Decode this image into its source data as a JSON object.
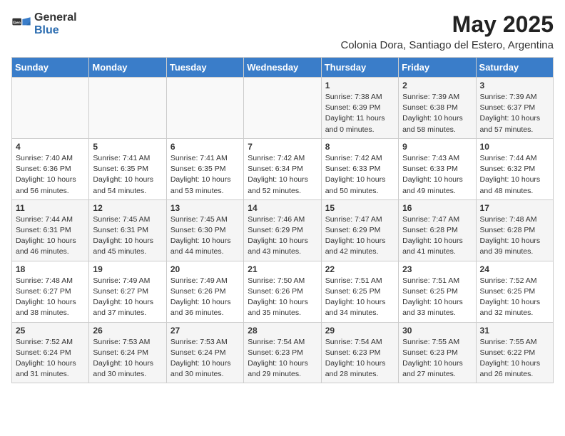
{
  "logo": {
    "general": "General",
    "blue": "Blue"
  },
  "title": "May 2025",
  "subtitle": "Colonia Dora, Santiago del Estero, Argentina",
  "days_of_week": [
    "Sunday",
    "Monday",
    "Tuesday",
    "Wednesday",
    "Thursday",
    "Friday",
    "Saturday"
  ],
  "weeks": [
    [
      {
        "num": "",
        "info": ""
      },
      {
        "num": "",
        "info": ""
      },
      {
        "num": "",
        "info": ""
      },
      {
        "num": "",
        "info": ""
      },
      {
        "num": "1",
        "info": "Sunrise: 7:38 AM\nSunset: 6:39 PM\nDaylight: 11 hours\nand 0 minutes."
      },
      {
        "num": "2",
        "info": "Sunrise: 7:39 AM\nSunset: 6:38 PM\nDaylight: 10 hours\nand 58 minutes."
      },
      {
        "num": "3",
        "info": "Sunrise: 7:39 AM\nSunset: 6:37 PM\nDaylight: 10 hours\nand 57 minutes."
      }
    ],
    [
      {
        "num": "4",
        "info": "Sunrise: 7:40 AM\nSunset: 6:36 PM\nDaylight: 10 hours\nand 56 minutes."
      },
      {
        "num": "5",
        "info": "Sunrise: 7:41 AM\nSunset: 6:35 PM\nDaylight: 10 hours\nand 54 minutes."
      },
      {
        "num": "6",
        "info": "Sunrise: 7:41 AM\nSunset: 6:35 PM\nDaylight: 10 hours\nand 53 minutes."
      },
      {
        "num": "7",
        "info": "Sunrise: 7:42 AM\nSunset: 6:34 PM\nDaylight: 10 hours\nand 52 minutes."
      },
      {
        "num": "8",
        "info": "Sunrise: 7:42 AM\nSunset: 6:33 PM\nDaylight: 10 hours\nand 50 minutes."
      },
      {
        "num": "9",
        "info": "Sunrise: 7:43 AM\nSunset: 6:33 PM\nDaylight: 10 hours\nand 49 minutes."
      },
      {
        "num": "10",
        "info": "Sunrise: 7:44 AM\nSunset: 6:32 PM\nDaylight: 10 hours\nand 48 minutes."
      }
    ],
    [
      {
        "num": "11",
        "info": "Sunrise: 7:44 AM\nSunset: 6:31 PM\nDaylight: 10 hours\nand 46 minutes."
      },
      {
        "num": "12",
        "info": "Sunrise: 7:45 AM\nSunset: 6:31 PM\nDaylight: 10 hours\nand 45 minutes."
      },
      {
        "num": "13",
        "info": "Sunrise: 7:45 AM\nSunset: 6:30 PM\nDaylight: 10 hours\nand 44 minutes."
      },
      {
        "num": "14",
        "info": "Sunrise: 7:46 AM\nSunset: 6:29 PM\nDaylight: 10 hours\nand 43 minutes."
      },
      {
        "num": "15",
        "info": "Sunrise: 7:47 AM\nSunset: 6:29 PM\nDaylight: 10 hours\nand 42 minutes."
      },
      {
        "num": "16",
        "info": "Sunrise: 7:47 AM\nSunset: 6:28 PM\nDaylight: 10 hours\nand 41 minutes."
      },
      {
        "num": "17",
        "info": "Sunrise: 7:48 AM\nSunset: 6:28 PM\nDaylight: 10 hours\nand 39 minutes."
      }
    ],
    [
      {
        "num": "18",
        "info": "Sunrise: 7:48 AM\nSunset: 6:27 PM\nDaylight: 10 hours\nand 38 minutes."
      },
      {
        "num": "19",
        "info": "Sunrise: 7:49 AM\nSunset: 6:27 PM\nDaylight: 10 hours\nand 37 minutes."
      },
      {
        "num": "20",
        "info": "Sunrise: 7:49 AM\nSunset: 6:26 PM\nDaylight: 10 hours\nand 36 minutes."
      },
      {
        "num": "21",
        "info": "Sunrise: 7:50 AM\nSunset: 6:26 PM\nDaylight: 10 hours\nand 35 minutes."
      },
      {
        "num": "22",
        "info": "Sunrise: 7:51 AM\nSunset: 6:25 PM\nDaylight: 10 hours\nand 34 minutes."
      },
      {
        "num": "23",
        "info": "Sunrise: 7:51 AM\nSunset: 6:25 PM\nDaylight: 10 hours\nand 33 minutes."
      },
      {
        "num": "24",
        "info": "Sunrise: 7:52 AM\nSunset: 6:25 PM\nDaylight: 10 hours\nand 32 minutes."
      }
    ],
    [
      {
        "num": "25",
        "info": "Sunrise: 7:52 AM\nSunset: 6:24 PM\nDaylight: 10 hours\nand 31 minutes."
      },
      {
        "num": "26",
        "info": "Sunrise: 7:53 AM\nSunset: 6:24 PM\nDaylight: 10 hours\nand 30 minutes."
      },
      {
        "num": "27",
        "info": "Sunrise: 7:53 AM\nSunset: 6:24 PM\nDaylight: 10 hours\nand 30 minutes."
      },
      {
        "num": "28",
        "info": "Sunrise: 7:54 AM\nSunset: 6:23 PM\nDaylight: 10 hours\nand 29 minutes."
      },
      {
        "num": "29",
        "info": "Sunrise: 7:54 AM\nSunset: 6:23 PM\nDaylight: 10 hours\nand 28 minutes."
      },
      {
        "num": "30",
        "info": "Sunrise: 7:55 AM\nSunset: 6:23 PM\nDaylight: 10 hours\nand 27 minutes."
      },
      {
        "num": "31",
        "info": "Sunrise: 7:55 AM\nSunset: 6:22 PM\nDaylight: 10 hours\nand 26 minutes."
      }
    ]
  ]
}
